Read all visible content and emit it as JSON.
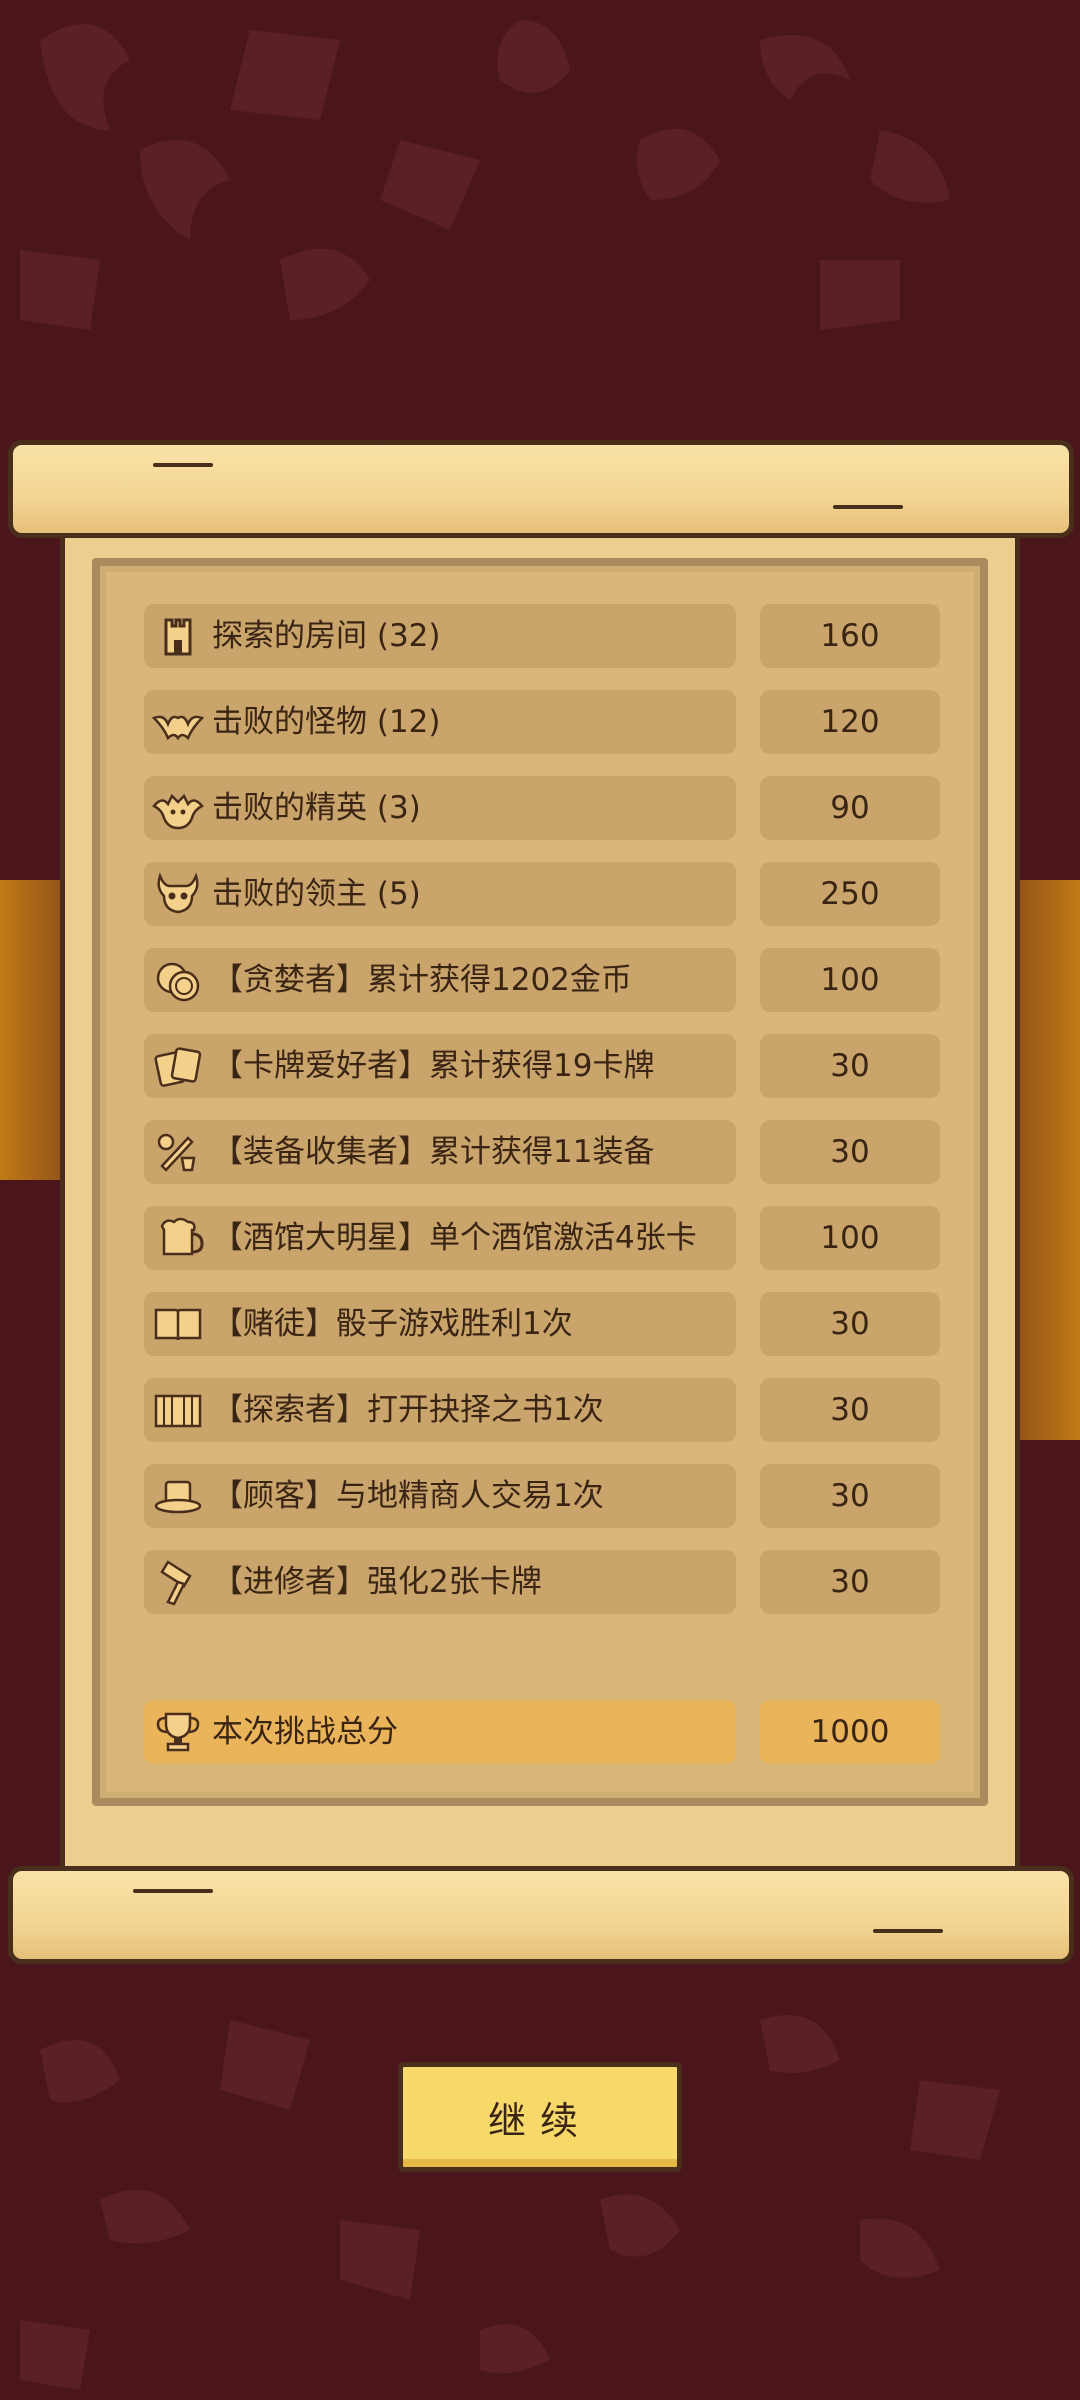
{
  "rows": [
    {
      "icon": "tower-icon",
      "label": "探索的房间 (32)",
      "value": "160"
    },
    {
      "icon": "bat-icon",
      "label": "击败的怪物 (12)",
      "value": "120"
    },
    {
      "icon": "elite-demon-icon",
      "label": "击败的精英 (3)",
      "value": "90"
    },
    {
      "icon": "boss-skull-icon",
      "label": "击败的领主 (5)",
      "value": "250"
    },
    {
      "icon": "coins-icon",
      "label": "【贪婪者】累计获得1202金币",
      "value": "100"
    },
    {
      "icon": "cards-icon",
      "label": "【卡牌爱好者】累计获得19卡牌",
      "value": "30"
    },
    {
      "icon": "equipment-icon",
      "label": "【装备收集者】累计获得11装备",
      "value": "30"
    },
    {
      "icon": "beer-mug-icon",
      "label": "【酒馆大明星】单个酒馆激活4张卡",
      "value": "100"
    },
    {
      "icon": "open-book-icon",
      "label": "【赌徒】骰子游戏胜利1次",
      "value": "30"
    },
    {
      "icon": "book-icon",
      "label": "【探索者】打开抉择之书1次",
      "value": "30"
    },
    {
      "icon": "top-hat-icon",
      "label": "【顾客】与地精商人交易1次",
      "value": "30"
    },
    {
      "icon": "hammer-icon",
      "label": "【进修者】强化2张卡牌",
      "value": "30"
    }
  ],
  "total": {
    "icon": "trophy-icon",
    "label": "本次挑战总分",
    "value": "1000"
  },
  "continue_label": "继续",
  "colors": {
    "background": "#4a161c",
    "paper": "#eccf90",
    "cell": "#c9a56b",
    "total_cell": "#eab55a",
    "button": "#f7d96a",
    "text": "#3a2414"
  }
}
